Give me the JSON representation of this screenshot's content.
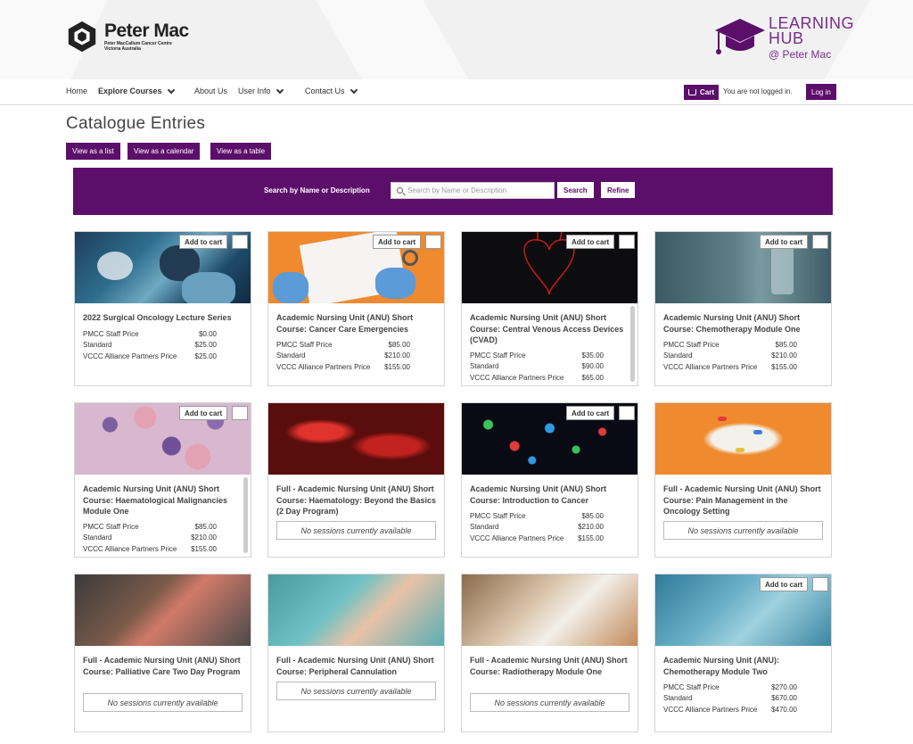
{
  "header": {
    "brand": "Peter Mac",
    "brand_sub1": "Peter MacCallum Cancer Centre",
    "brand_sub2": "Victoria Australia",
    "hub_line1": "LEARNING",
    "hub_line2": "HUB",
    "hub_line3": "@ Peter Mac",
    "accent_color": "#5c0e6b"
  },
  "nav": {
    "home": "Home",
    "explore": "Explore Courses",
    "about": "About Us",
    "user_info": "User Info",
    "contact": "Contact Us",
    "cart": "Cart",
    "login_status": "You are not logged in.",
    "login": "Log in"
  },
  "page": {
    "title": "Catalogue Entries",
    "view_list": "View as a list",
    "view_calendar": "View as a calendar",
    "view_table": "View as a table"
  },
  "search": {
    "label": "Search by Name or Description",
    "placeholder": "Search by Name or Description",
    "search_btn": "Search",
    "refine_btn": "Refine"
  },
  "cards": [
    {
      "title": "2022 Surgical Oncology Lecture Series",
      "add": "Add to cart",
      "prices": [
        [
          "PMCC Staff Price",
          "$0.00"
        ],
        [
          "Standard",
          "$25.00"
        ],
        [
          "VCCC Alliance Partners Price",
          "$25.00"
        ]
      ]
    },
    {
      "title": "Academic Nursing Unit (ANU) Short Course: Cancer Care Emergencies",
      "add": "Add to cart",
      "prices": [
        [
          "PMCC Staff Price",
          "$85.00"
        ],
        [
          "Standard",
          "$210.00"
        ],
        [
          "VCCC Alliance Partners Price",
          "$155.00"
        ]
      ]
    },
    {
      "title": "Academic Nursing Unit (ANU) Short Course: Central Venous Access Devices (CVAD)",
      "add": "Add to cart",
      "prices": [
        [
          "PMCC Staff Price",
          "$35.00"
        ],
        [
          "Standard",
          "$90.00"
        ],
        [
          "VCCC Alliance Partners Price",
          "$65.00"
        ]
      ]
    },
    {
      "title": "Academic Nursing Unit (ANU) Short Course: Chemotherapy Module One",
      "add": "Add to cart",
      "prices": [
        [
          "PMCC Staff Price",
          "$85.00"
        ],
        [
          "Standard",
          "$210.00"
        ],
        [
          "VCCC Alliance Partners Price",
          "$155.00"
        ]
      ]
    },
    {
      "title": "Academic Nursing Unit (ANU) Short Course: Haematological Malignancies Module One",
      "add": "Add to cart",
      "prices": [
        [
          "PMCC Staff Price",
          "$85.00"
        ],
        [
          "Standard",
          "$210.00"
        ],
        [
          "VCCC Alliance Partners Price",
          "$155.00"
        ]
      ]
    },
    {
      "title": "Full - Academic Nursing Unit (ANU) Short Course: Haematology: Beyond the Basics (2 Day Program)",
      "none": "No sessions currently available"
    },
    {
      "title": "Academic Nursing Unit (ANU) Short Course: Introduction to Cancer",
      "add": "Add to cart",
      "prices": [
        [
          "PMCC Staff Price",
          "$85.00"
        ],
        [
          "Standard",
          "$210.00"
        ],
        [
          "VCCC Alliance Partners Price",
          "$155.00"
        ]
      ]
    },
    {
      "title": "Full - Academic Nursing Unit (ANU) Short Course: Pain Management in the Oncology Setting",
      "none": "No sessions currently available"
    },
    {
      "title": "Full - Academic Nursing Unit (ANU) Short Course: Palliative Care Two Day Program",
      "none": "No sessions currently available"
    },
    {
      "title": "Full - Academic Nursing Unit (ANU) Short Course: Peripheral Cannulation",
      "none": "No sessions currently available"
    },
    {
      "title": "Full - Academic Nursing Unit (ANU) Short Course: Radiotherapy Module One",
      "none": "No sessions currently available"
    },
    {
      "title": "Academic Nursing Unit (ANU): Chemotherapy Module Two",
      "add": "Add to cart",
      "prices": [
        [
          "PMCC Staff Price",
          "$270.00"
        ],
        [
          "Standard",
          "$670.00"
        ],
        [
          "VCCC Alliance Partners Price",
          "$470.00"
        ]
      ]
    }
  ]
}
